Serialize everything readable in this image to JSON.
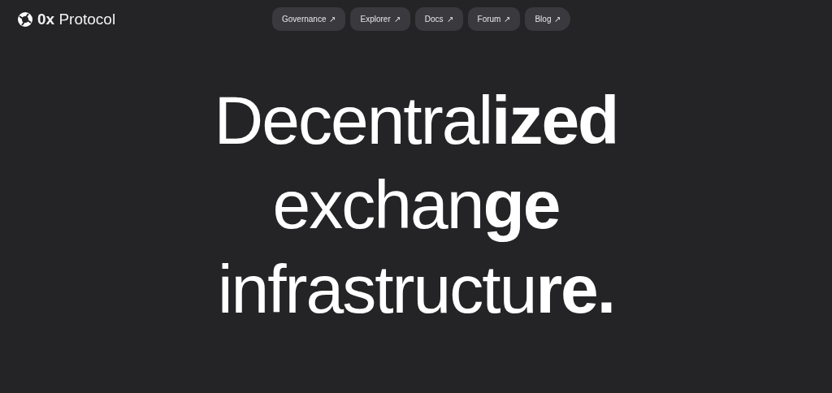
{
  "logo": {
    "text": "**0x** Protocol"
  },
  "nav": [
    {
      "label": "Governance",
      "icon": "↗"
    },
    {
      "label": "Explorer",
      "icon": "↗"
    },
    {
      "label": "Docs",
      "icon": "↗"
    },
    {
      "label": "Forum",
      "icon": "↗"
    },
    {
      "label": "Blog",
      "icon": "↗"
    }
  ],
  "headline": "Decentral**ized**\nexchan**ge**\ninfrastructu**re.**"
}
